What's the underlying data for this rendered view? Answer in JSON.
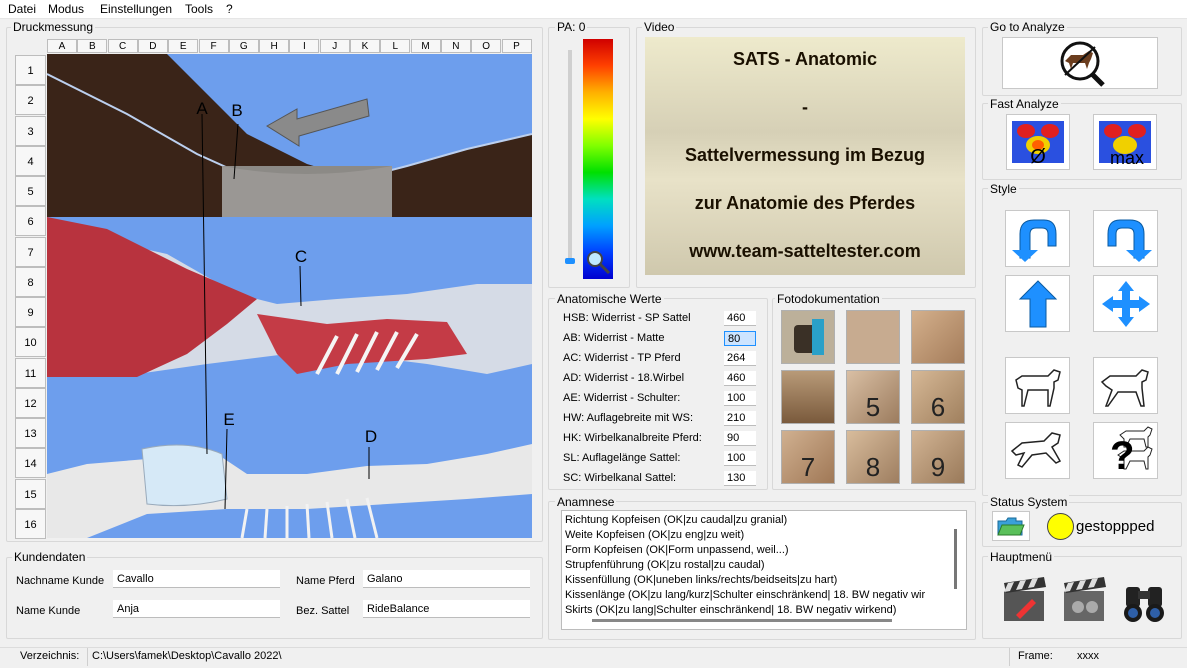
{
  "menu": [
    "Datei",
    "Modus",
    "Einstellungen",
    "Tools",
    "?"
  ],
  "druck": {
    "label": "Druckmessung",
    "columns": [
      "A",
      "B",
      "C",
      "D",
      "E",
      "F",
      "G",
      "H",
      "I",
      "J",
      "K",
      "L",
      "M",
      "N",
      "O",
      "P"
    ],
    "rows": [
      "1",
      "2",
      "3",
      "4",
      "5",
      "6",
      "7",
      "8",
      "9",
      "10",
      "11",
      "12",
      "13",
      "14",
      "15",
      "16"
    ],
    "markers": [
      "A",
      "B",
      "C",
      "D",
      "E"
    ]
  },
  "pa": {
    "label": "PA: 0"
  },
  "video": {
    "label": "Video",
    "lines": [
      "SATS - Anatomic",
      "-",
      "Sattelvermessung im Bezug",
      "zur Anatomie des Pferdes",
      "www.team-satteltester.com"
    ]
  },
  "anat": {
    "label": "Anatomische Werte",
    "rows": [
      {
        "label": "HSB: Widerrist - SP Sattel",
        "value": "460"
      },
      {
        "label": "AB: Widerrist - Matte",
        "value": "80"
      },
      {
        "label": "AC: Widerrist - TP Pferd",
        "value": "264"
      },
      {
        "label": "AD: Widerrist - 18.Wirbel",
        "value": "460"
      },
      {
        "label": "AE: Widerrist - Schulter:",
        "value": "100"
      },
      {
        "label": "HW: Auflagebreite mit WS:",
        "value": "210"
      },
      {
        "label": "HK: Wirbelkanalbreite Pferd:",
        "value": "90"
      },
      {
        "label": "SL: Auflagelänge Sattel:",
        "value": "100"
      },
      {
        "label": "SC: Wirbelkanal Sattel:",
        "value": "130"
      }
    ]
  },
  "foto": {
    "label": "Fotodokumentation",
    "numbers": [
      "5",
      "6",
      "7",
      "8",
      "9"
    ]
  },
  "anamnese": {
    "label": "Anamnese",
    "lines": [
      "Richtung Kopfeisen (OK|zu caudal|zu granial)",
      "Weite Kopfeisen (OK|zu eng|zu weit)",
      "Form Kopfeisen (OK|Form unpassend, weil...)",
      "Strupfenführung (OK|zu rostal|zu caudal)",
      "Kissenfüllung (OK|uneben links/rechts/beidseits|zu hart)",
      "Kissenlänge (OK|zu lang/kurz|Schulter einschränkend| 18. BW negativ wir",
      "Skirts (OK|zu lang|Schulter einschränkend| 18. BW negativ wirkend)"
    ]
  },
  "kunden": {
    "label": "Kundendaten",
    "nachname_label": "Nachname Kunde",
    "nachname": "Cavallo",
    "name_label": "Name Kunde",
    "name": "Anja",
    "pferd_label": "Name Pferd",
    "pferd": "Galano",
    "sattel_label": "Bez. Sattel",
    "sattel": "RideBalance"
  },
  "right": {
    "goto_label": "Go to Analyze",
    "fast_label": "Fast Analyze",
    "fast_avg": "Ø",
    "fast_max": "max",
    "style_label": "Style",
    "status_label": "Status System",
    "status_text": "gestoppped",
    "haupt_label": "Hauptmenü"
  },
  "statusbar": {
    "verz_label": "Verzeichnis:",
    "verz_value": "C:\\Users\\famek\\Desktop\\Cavallo 2022\\",
    "frame_label": "Frame:",
    "frame_value": "xxxx"
  },
  "colors": {
    "accent": "#1e90ff",
    "status_dot": "#ffff00",
    "sky": "#6d9eed"
  }
}
